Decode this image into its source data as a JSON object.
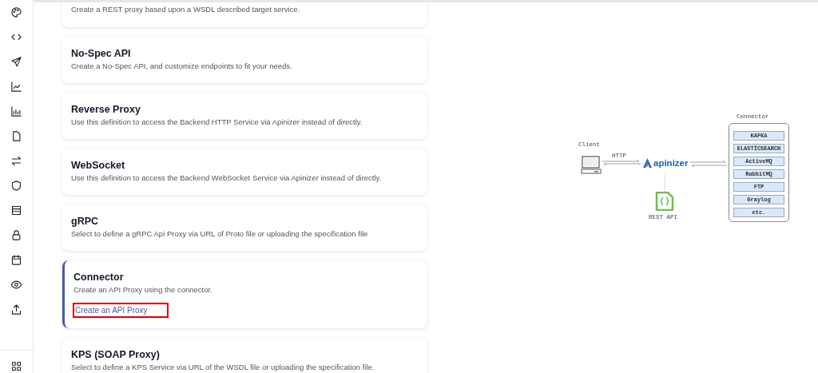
{
  "cards": [
    {
      "description": "Create a REST proxy based upon a WSDL described target service.",
      "selected": false
    },
    {
      "title": "No-Spec API",
      "description": "Create a No-Spec API, and customize endpoints to fit your needs.",
      "selected": false
    },
    {
      "title": "Reverse Proxy",
      "description": "Use this definition to access the Backend HTTP Service via Apinizer instead of directly.",
      "selected": false
    },
    {
      "title": "WebSocket",
      "description": "Use this definition to access the Backend WebSocket Service via Apinizer instead of directly.",
      "selected": false
    },
    {
      "title": "gRPC",
      "description": "Select to define a gRPC Api Proxy via URL of Proto file or uploading the specification file",
      "selected": false
    },
    {
      "title": "Connector",
      "description": "Create an API Proxy using the connector.",
      "selected": true,
      "link": {
        "label": "Create an API Proxy",
        "highlighted": true
      }
    },
    {
      "title": "KPS (SOAP Proxy)",
      "description": "Select to define a KPS Service via URL of the WSDL file or uploading the specification file.",
      "selected": false
    }
  ],
  "diagram": {
    "client_label": "Client",
    "protocol_label": "HTTP",
    "gateway_label": "apinizer",
    "file_label": "REST API",
    "connector_label": "Connector",
    "connectors": [
      "KAFKA",
      "ELASTİCSEARCH",
      "ActiveMQ",
      "RabbitMQ",
      "FTP",
      "Graylog",
      "etc."
    ]
  }
}
